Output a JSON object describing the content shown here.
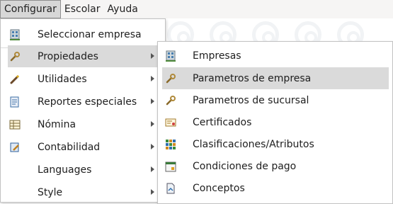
{
  "menubar": {
    "items": [
      {
        "label": "Configurar"
      },
      {
        "label": "Escolar"
      },
      {
        "label": "Ayuda"
      }
    ]
  },
  "configurar_menu": {
    "items": [
      {
        "label": "Seleccionar empresa",
        "icon": "building-icon"
      },
      {
        "label": "Propiedades",
        "icon": "wrench-icon"
      },
      {
        "label": "Utilidades",
        "icon": "pencil-icon"
      },
      {
        "label": "Reportes especiales",
        "icon": "report-icon"
      },
      {
        "label": "Nómina",
        "icon": "table-icon"
      },
      {
        "label": "Contabilidad",
        "icon": "ledger-icon"
      },
      {
        "label": "Languages",
        "icon": ""
      },
      {
        "label": "Style",
        "icon": ""
      }
    ]
  },
  "propiedades_menu": {
    "items": [
      {
        "label": "Empresas",
        "icon": "building-icon"
      },
      {
        "label": "Parametros de empresa",
        "icon": "wrench-icon"
      },
      {
        "label": "Parametros de sucursal",
        "icon": "wrench-icon"
      },
      {
        "label": "Certificados",
        "icon": "certificate-icon"
      },
      {
        "label": "Clasificaciones/Atributos",
        "icon": "grid-icon"
      },
      {
        "label": "Condiciones de pago",
        "icon": "calendar-icon"
      },
      {
        "label": "Conceptos",
        "icon": "document-icon"
      }
    ]
  },
  "colors": {
    "highlight": "#dadada",
    "accent": "#2d7fc3"
  }
}
